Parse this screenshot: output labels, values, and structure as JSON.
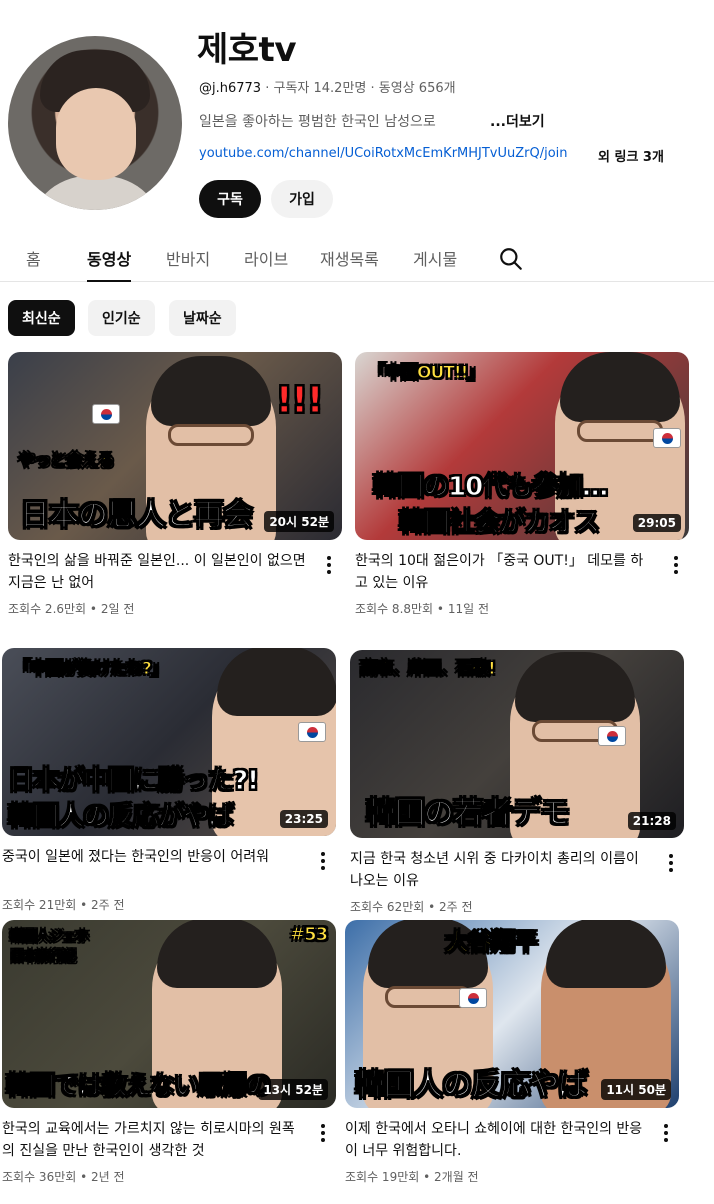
{
  "channel": {
    "name": "제호tv",
    "handle": "@j.h6773",
    "subscribers": "구독자 14.2만명",
    "video_count": "동영상 656개",
    "description": "일본을 좋아하는 평범한 한국인 남성으로",
    "more": "...더보기",
    "link": "youtube.com/channel/UCoiRotxMcEmKrMHJTvUuZrQ/join",
    "link_extra": "외 링크 3개",
    "subscribe_label": "구독",
    "join_label": "가입"
  },
  "tabs": [
    {
      "label": "홈"
    },
    {
      "label": "동영상"
    },
    {
      "label": "반바지"
    },
    {
      "label": "라이브"
    },
    {
      "label": "재생목록"
    },
    {
      "label": "게시물"
    }
  ],
  "chips": [
    {
      "label": "최신순"
    },
    {
      "label": "인기순"
    },
    {
      "label": "날짜순"
    }
  ],
  "videos": [
    {
      "title": "한국인의 삶을 바꿔준 일본인... 이 일본인이 없으면 지금은 난 없어",
      "views": "조회수 2.6만회",
      "age": "2일 전",
      "duration": "20시 52분",
      "caption_main": "日本の恩人と再会",
      "caption_top": "やっと会える",
      "badge": "!!!"
    },
    {
      "title": "한국의 10대 젊은이가 「중국 OUT!」 데모를 하고 있는 이유",
      "views": "조회수 8.8만회",
      "age": "11일 전",
      "duration": "29:05",
      "caption_main": "韓国の10代も参加…",
      "caption_main2": "韓国社会がカオス",
      "caption_top": "「中国OUT!!」"
    },
    {
      "title": "중국이 일본에 졌다는 한국인의 반응이 어려워",
      "views": "조회수 21만회",
      "age": "2주 전",
      "duration": "23:25",
      "caption_main": "日本が中国に勝った?!",
      "caption_main2": "韓国人の反応がやば",
      "caption_top": "「中国が負けたね?」"
    },
    {
      "title": "지금 한국 청소년 시위 중 다카이치 총리의 이름이 나오는 이유",
      "views": "조회수 62만회",
      "age": "2주 전",
      "duration": "21:28",
      "caption_main": "韓国の若者デモ",
      "caption_top": "高市、岸田、石破!"
    },
    {
      "title": "한국의 교육에서는 가르치지 않는 히로시마의 원폭의 진실을 만난 한국인이 생각한 것",
      "views": "조회수 36만회",
      "age": "2년 전",
      "duration": "13시 52분",
      "caption_main": "韓国では教えない原爆の",
      "caption_top": "韓国人ジェホ 日本旅行記",
      "badge": "#53"
    },
    {
      "title": "이제 한국에서 오타니 쇼헤이에 대한 한국인의 반응이 너무 위험합니다.",
      "views": "조회수 19만회",
      "age": "2개월 전",
      "duration": "11시 50분",
      "caption_main": "韓国人の反応やば",
      "caption_top": "大谷翔平"
    }
  ]
}
